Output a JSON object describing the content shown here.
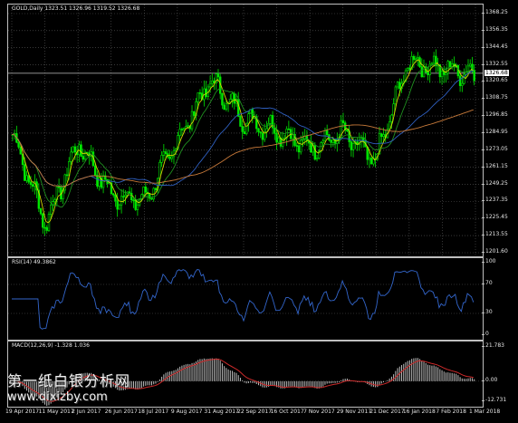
{
  "main": {
    "title": "GOLD,Daily  1323.51 1326.96 1319.52 1326.68",
    "y_ticks": [
      "1368.25",
      "1356.35",
      "1344.45",
      "1332.55",
      "1320.65",
      "1308.75",
      "1296.85",
      "1284.95",
      "1273.05",
      "1261.15",
      "1249.25",
      "1237.35",
      "1225.45",
      "1213.55",
      "1201.60"
    ],
    "current_price": "1326.68",
    "ylim": [
      1201.6,
      1368.25
    ]
  },
  "rsi": {
    "title": "RSI(14) 49.3862",
    "y_ticks": [
      "100",
      "70",
      "30",
      "0"
    ],
    "levels": [
      70,
      30
    ]
  },
  "macd": {
    "title": "MACD(12,26,9) -1.328 1.036",
    "y_ticks": [
      "21.783",
      "0.00",
      "-12.731"
    ]
  },
  "x_labels": [
    "19 Apr 2017",
    "11 May 2017",
    "2 Jun 2017",
    "26 Jun 2017",
    "18 Jul 2017",
    "9 Aug 2017",
    "31 Aug 2017",
    "22 Sep 2017",
    "16 Oct 2017",
    "7 Nov 2017",
    "29 Nov 2017",
    "21 Dec 2017",
    "16 Jan 2018",
    "7 Feb 2018",
    "1 Mar 2018"
  ],
  "watermark": {
    "line1": "第一纸白银分析网",
    "line2": "www.dixizby.com"
  },
  "colors": {
    "candle_up": "#00e600",
    "candle_down": "#00e600",
    "ma_fast": "#d4d400",
    "ma_mid": "#1f8f1f",
    "ma_slow": "#2f5fbf",
    "ma_long": "#c87a3a",
    "rsi": "#3366cc",
    "macd_hist": "#bfbfbf",
    "macd_signal": "#cc2a2a",
    "grid": "#5a5a5a"
  },
  "chart_data": {
    "type": "line",
    "title": "GOLD,Daily",
    "close_approx": [
      {
        "x": "19 Apr 2017",
        "y": 1284
      },
      {
        "x": "11 May 2017",
        "y": 1222
      },
      {
        "x": "2 Jun 2017",
        "y": 1278
      },
      {
        "x": "26 Jun 2017",
        "y": 1242
      },
      {
        "x": "18 Jul 2017",
        "y": 1238
      },
      {
        "x": "9 Aug 2017",
        "y": 1280
      },
      {
        "x": "31 Aug 2017",
        "y": 1322
      },
      {
        "x": "22 Sep 2017",
        "y": 1295
      },
      {
        "x": "16 Oct 2017",
        "y": 1287
      },
      {
        "x": "7 Nov 2017",
        "y": 1275
      },
      {
        "x": "29 Nov 2017",
        "y": 1285
      },
      {
        "x": "21 Dec 2017",
        "y": 1265
      },
      {
        "x": "16 Jan 2018",
        "y": 1335
      },
      {
        "x": "7 Feb 2018",
        "y": 1330
      },
      {
        "x": "1 Mar 2018",
        "y": 1326.68
      }
    ],
    "ylim": [
      1201.6,
      1368.25
    ]
  }
}
